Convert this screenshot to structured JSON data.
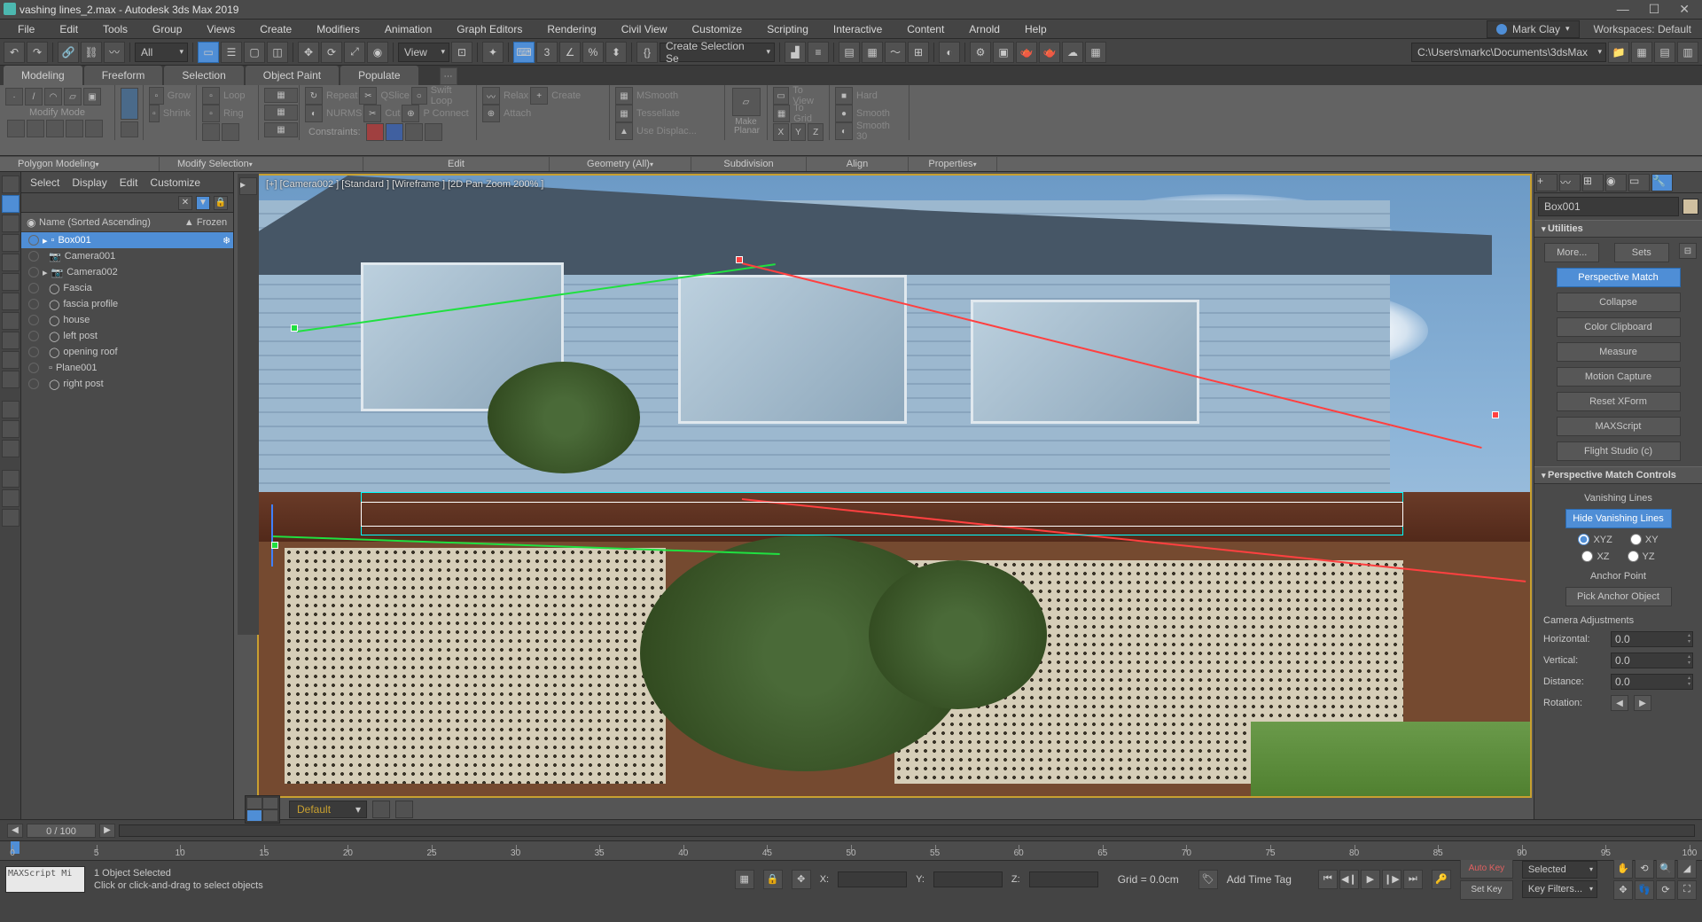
{
  "title": "vashing lines_2.max - Autodesk 3ds Max 2019",
  "menus": [
    "File",
    "Edit",
    "Tools",
    "Group",
    "Views",
    "Create",
    "Modifiers",
    "Animation",
    "Graph Editors",
    "Rendering",
    "Civil View",
    "Customize",
    "Scripting",
    "Interactive",
    "Content",
    "Arnold",
    "Help"
  ],
  "user": "Mark Clay",
  "workspaces_label": "Workspaces: Default",
  "toolbar": {
    "filter": "All",
    "view": "View",
    "selection_set": "Create Selection Se",
    "project_path": "C:\\Users\\markc\\Documents\\3dsMax"
  },
  "ribbon": {
    "tabs": [
      "Modeling",
      "Freeform",
      "Selection",
      "Object Paint",
      "Populate"
    ],
    "groups": {
      "modify_mode": "Modify Mode",
      "polygon_modeling": "Polygon Modeling",
      "shrink": "Shrink",
      "grow": "Grow",
      "loop": "Loop",
      "ring": "Ring",
      "modify_selection": "Modify Selection",
      "repeat": "Repeat",
      "nurms": "NURMS",
      "qslice": "QSlice",
      "cut": "Cut",
      "swift_loop": "Swift Loop",
      "p_connect": "P Connect",
      "constraints": "Constraints:",
      "edit": "Edit",
      "relax": "Relax",
      "attach": "Attach",
      "create": "Create",
      "geometry_all": "Geometry (All)",
      "msmooth": "MSmooth",
      "tessellate": "Tessellate",
      "use_displace": "Use Displac...",
      "subdivision": "Subdivision",
      "make_planar": "Make Planar",
      "to_view": "To View",
      "to_grid": "To Grid",
      "x": "X",
      "y": "Y",
      "z": "Z",
      "align": "Align",
      "hard": "Hard",
      "smooth": "Smooth",
      "smooth30": "Smooth 30",
      "properties": "Properties"
    }
  },
  "scene_explorer": {
    "tabs": [
      "Select",
      "Display",
      "Edit",
      "Customize"
    ],
    "header_name": "Name (Sorted Ascending)",
    "header_frozen": "▲ Frozen",
    "items": [
      {
        "name": "Box001",
        "selected": true,
        "type": "geom"
      },
      {
        "name": "Camera001",
        "type": "cam"
      },
      {
        "name": "Camera002",
        "type": "cam"
      },
      {
        "name": "Fascia",
        "type": "shape"
      },
      {
        "name": "fascia profile",
        "type": "shape"
      },
      {
        "name": "house",
        "type": "shape"
      },
      {
        "name": "left post",
        "type": "shape"
      },
      {
        "name": "opening roof",
        "type": "shape"
      },
      {
        "name": "Plane001",
        "type": "geom"
      },
      {
        "name": "right post",
        "type": "shape"
      }
    ]
  },
  "viewport": {
    "label": "[+] [Camera002 ] [Standard ] [Wireframe ] [2D Pan Zoom 200% ]",
    "default_layout": "Default"
  },
  "command_panel": {
    "object_name": "Box001",
    "utilities_title": "Utilities",
    "more": "More...",
    "sets": "Sets",
    "buttons": [
      "Perspective Match",
      "Collapse",
      "Color Clipboard",
      "Measure",
      "Motion Capture",
      "Reset XForm",
      "MAXScript",
      "Flight Studio (c)"
    ],
    "pm_controls_title": "Perspective Match Controls",
    "vanishing_lines": "Vanishing Lines",
    "hide_vanishing": "Hide Vanishing Lines",
    "axes": {
      "xyz": "XYZ",
      "xy": "XY",
      "xz": "XZ",
      "yz": "YZ"
    },
    "anchor_point": "Anchor Point",
    "pick_anchor": "Pick Anchor Object",
    "camera_adjustments": "Camera Adjustments",
    "horizontal": {
      "label": "Horizontal:",
      "value": "0.0"
    },
    "vertical": {
      "label": "Vertical:",
      "value": "0.0"
    },
    "distance": {
      "label": "Distance:",
      "value": "0.0"
    },
    "rotation": {
      "label": "Rotation:"
    }
  },
  "timeline": {
    "frame_display": "0 / 100",
    "ticks": [
      0,
      5,
      10,
      15,
      20,
      25,
      30,
      35,
      40,
      45,
      50,
      55,
      60,
      65,
      70,
      75,
      80,
      85,
      90,
      95,
      100
    ]
  },
  "status": {
    "maxscript": "MAXScript Mi",
    "selected": "1 Object Selected",
    "hint": "Click or click-and-drag to select objects",
    "x_label": "X:",
    "y_label": "Y:",
    "z_label": "Z:",
    "grid": "Grid = 0.0cm",
    "add_time_tag": "Add Time Tag",
    "auto_key": "Auto Key",
    "set_key": "Set Key",
    "selected_filter": "Selected",
    "key_filters": "Key Filters..."
  }
}
